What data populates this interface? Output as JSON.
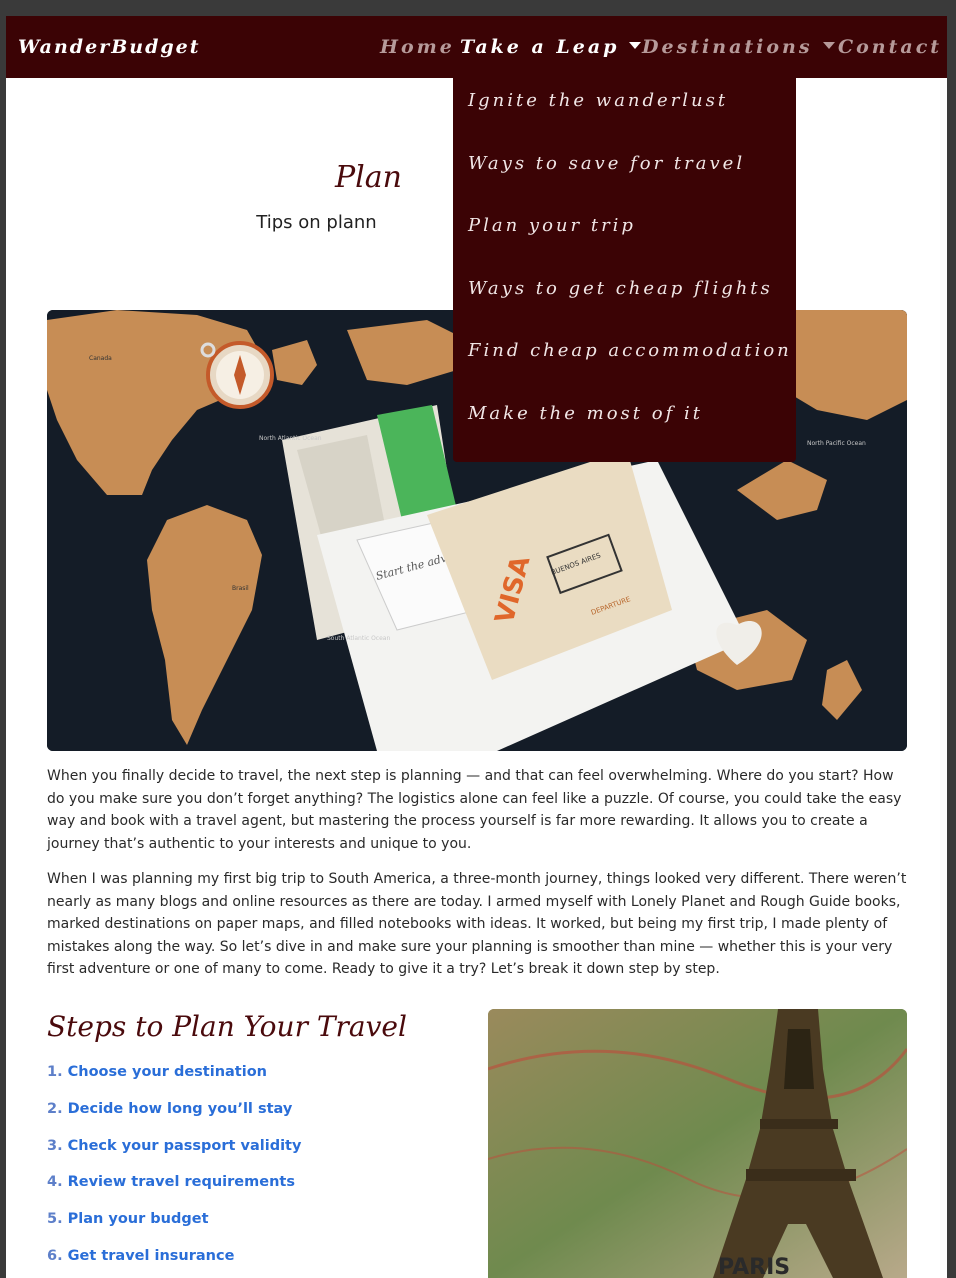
{
  "navbar": {
    "brand": "WanderBudget",
    "items": [
      {
        "label": "Home",
        "has_caret": false
      },
      {
        "label": "Take a Leap",
        "has_caret": true,
        "active": true
      },
      {
        "label": "Destinations",
        "has_caret": true
      },
      {
        "label": "Contact",
        "has_caret": false
      }
    ]
  },
  "dropdown": {
    "items": [
      "Ignite the wanderlust",
      "Ways to save for travel",
      "Plan your trip",
      "Ways to get cheap flights",
      "Find cheap accommodation",
      "Make the most of it"
    ]
  },
  "header": {
    "title_visible": "Plan",
    "subtitle_visible": "Tips on plann"
  },
  "article": {
    "paragraphs": [
      "When you finally decide to travel, the next step is planning — and that can feel overwhelming. Where do you start? How do you make sure you don’t forget anything? The logistics alone can feel like a puzzle. Of course, you could take the easy way and book with a travel agent, but mastering the process yourself is far more rewarding. It allows you to create a journey that’s authentic to your interests and unique to you.",
      "When I was planning my first big trip to South America, a three-month journey, things looked very different. There weren’t nearly as many blogs and online resources as there are today. I armed myself with Lonely Planet and Rough Guide books, marked destinations on paper maps, and filled notebooks with ideas. It worked, but being my first trip, I made plenty of mistakes along the way. So let’s dive in and make sure your planning is smoother than mine — whether this is your very first adventure or one of many to come. Ready to give it a try? Let’s break it down step by step."
    ]
  },
  "steps": {
    "heading": "Steps to Plan Your Travel",
    "items": [
      {
        "num": "1.",
        "label": "Choose your destination"
      },
      {
        "num": "2.",
        "label": "Decide how long you’ll stay"
      },
      {
        "num": "3.",
        "label": "Check your passport validity"
      },
      {
        "num": "4.",
        "label": "Review travel requirements"
      },
      {
        "num": "5.",
        "label": "Plan your budget"
      },
      {
        "num": "6.",
        "label": "Get travel insurance"
      }
    ]
  },
  "hero_image": {
    "text": {
      "compass_note": "Start the adventure",
      "stamp_visa": "VISA",
      "stamp_city": "BUENOS AIRES",
      "stamp_departure": "DEPARTURE",
      "ocean_label": "North Atlantic Ocean",
      "ocean_label_2": "North Pacific Ocean",
      "ocean_label_3": "South Atlantic Ocean",
      "country_label": "Canada",
      "country_label_2": "Brasil"
    }
  },
  "eiffel_image": {
    "text": {
      "map_label": "PARIS"
    }
  },
  "colors": {
    "navbar_bg": "#3b0305",
    "heading": "#4a0a0c",
    "link": "#2a6ed8",
    "nav_inactive": "#b69a9a"
  }
}
